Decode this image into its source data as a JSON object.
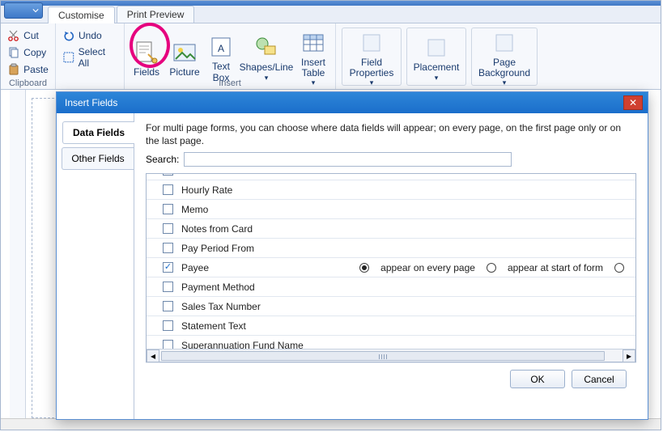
{
  "tabs": {
    "customise": "Customise",
    "printPreview": "Print Preview"
  },
  "clipboard": {
    "group_label": "Clipboard",
    "cut": "Cut",
    "copy": "Copy",
    "paste": "Paste",
    "undo": "Undo",
    "selectAll": "Select All"
  },
  "insert": {
    "group_label": "Insert",
    "fields": "Fields",
    "picture": "Picture",
    "textBox": "Text\nBox",
    "shapesLine": "Shapes/Line",
    "insertTable": "Insert\nTable"
  },
  "props": {
    "fieldProperties": "Field\nProperties",
    "placement": "Placement",
    "pageBackground": "Page\nBackground"
  },
  "insert_fields": {
    "title": "Insert Fields",
    "side": {
      "dataFields": "Data Fields",
      "otherFields": "Other Fields"
    },
    "description": "For multi page forms, you can choose where data fields will appear; on every page, on the first page only or on the last page.",
    "search_label": "Search:",
    "search_value": "",
    "radio": {
      "every": "appear on every page",
      "start": "appear at start of form"
    },
    "rows": [
      {
        "label": "",
        "checked": false
      },
      {
        "label": "Hourly Rate",
        "checked": false
      },
      {
        "label": "Memo",
        "checked": false
      },
      {
        "label": "Notes from Card",
        "checked": false
      },
      {
        "label": "Pay Period From",
        "checked": false
      },
      {
        "label": "Payee",
        "checked": true,
        "radio": "every"
      },
      {
        "label": "Payment Method",
        "checked": false
      },
      {
        "label": "Sales Tax Number",
        "checked": false
      },
      {
        "label": "Statement Text",
        "checked": false
      },
      {
        "label": "Superannuation Fund Name",
        "checked": false
      }
    ],
    "buttons": {
      "ok": "OK",
      "cancel": "Cancel"
    }
  }
}
